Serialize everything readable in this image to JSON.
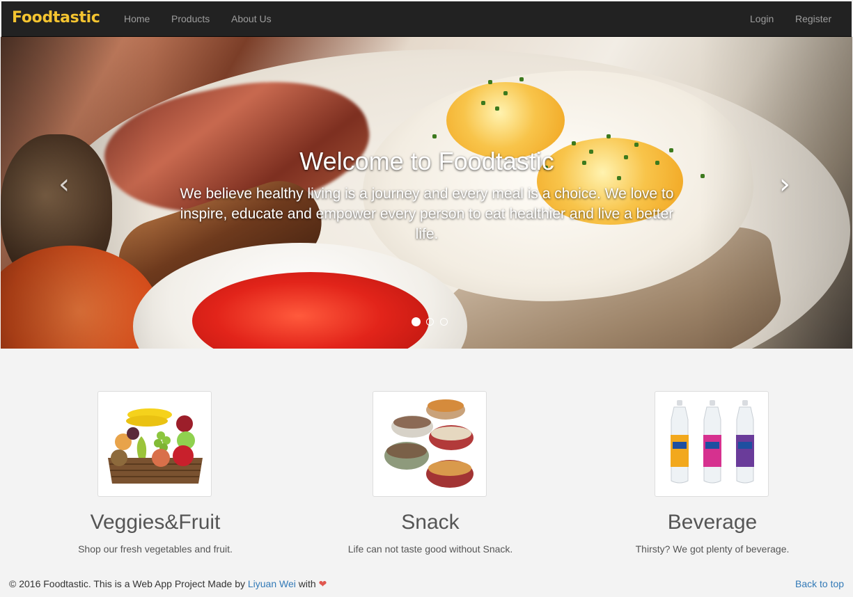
{
  "navbar": {
    "brand": "Foodtastic",
    "links": [
      "Home",
      "Products",
      "About Us"
    ],
    "right_links": [
      "Login",
      "Register"
    ],
    "brand_color": "#f4c430",
    "background": "#222222"
  },
  "carousel": {
    "title": "Welcome to Foodtastic",
    "text": "We believe healthy living is a journey and every meal is a choice. We love to inspire, educate and empower every person to eat healthier and live a better life.",
    "prev_icon": "chevron-left-icon",
    "next_icon": "chevron-right-icon",
    "prev_glyph": "‹",
    "next_glyph": "›",
    "slide_count": 3,
    "active_slide": 1
  },
  "categories": [
    {
      "title": "Veggies&Fruit",
      "description": "Shop our fresh vegetables and fruit.",
      "image": "fruit-basket"
    },
    {
      "title": "Snack",
      "description": "Life can not taste good without Snack.",
      "image": "snack-bowls"
    },
    {
      "title": "Beverage",
      "description": "Thirsty? We got plenty of beverage.",
      "image": "water-bottles"
    }
  ],
  "footer": {
    "copyright": "© 2016 Foodtastic. This is a Web App Project Made by",
    "author": "Liyuan Wei",
    "with": "with",
    "heart": "❤",
    "back_to_top": "Back to top",
    "link_color": "#337ab7"
  }
}
